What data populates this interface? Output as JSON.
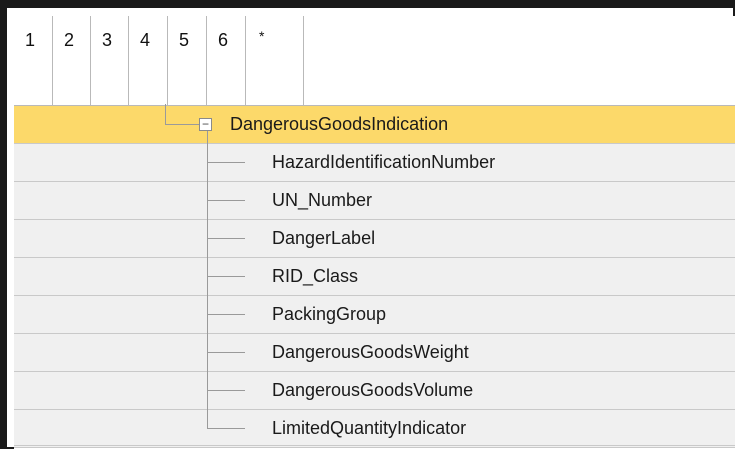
{
  "header": {
    "levels": [
      "1",
      "2",
      "3",
      "4",
      "5",
      "6",
      "*"
    ]
  },
  "tree": {
    "parent": {
      "label": "DangerousGoodsIndication",
      "expander_icon": "minus-box-icon",
      "selected": true
    },
    "children": [
      "HazardIdentificationNumber",
      "UN_Number",
      "DangerLabel",
      "RID_Class",
      "PackingGroup",
      "DangerousGoodsWeight",
      "DangerousGoodsVolume",
      "LimitedQuantityIndicator"
    ]
  },
  "colors": {
    "selected_row": "#fcd96a",
    "row_background": "#f0f0f0",
    "grid_line": "#c9c9c9",
    "frame": "#1a1a1a"
  }
}
